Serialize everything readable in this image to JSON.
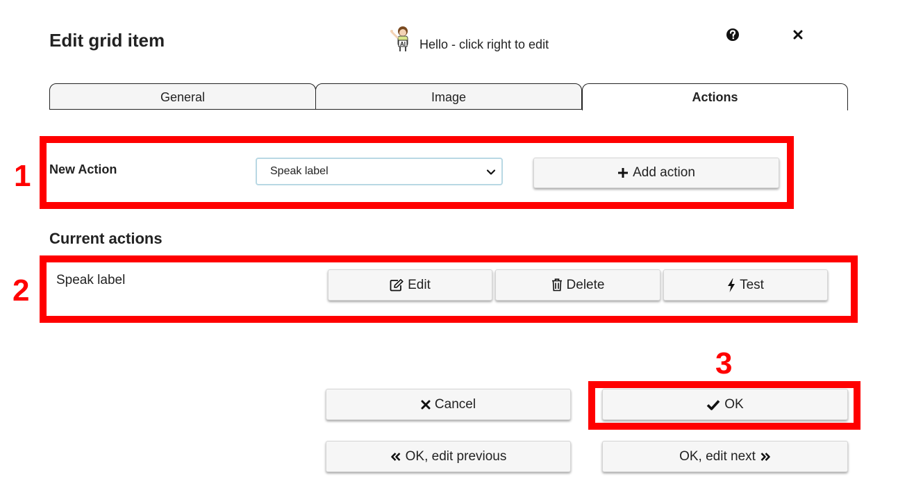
{
  "dialog": {
    "title": "Edit grid item",
    "hello_text": "Hello - click right to edit"
  },
  "tabs": [
    {
      "label": "General",
      "active": false
    },
    {
      "label": "Image",
      "active": false
    },
    {
      "label": "Actions",
      "active": true
    }
  ],
  "new_action": {
    "label": "New Action",
    "select_value": "Speak label",
    "add_button": "Add action"
  },
  "current_actions": {
    "title": "Current actions",
    "items": [
      {
        "name": "Speak label",
        "edit": "Edit",
        "delete": "Delete",
        "test": "Test"
      }
    ]
  },
  "footer": {
    "cancel": "Cancel",
    "ok": "OK",
    "ok_prev": "OK, edit previous",
    "ok_next": "OK, edit next"
  },
  "annotations": {
    "one": "1",
    "two": "2",
    "three": "3",
    "color": "#ff0000"
  },
  "icons": {
    "help": "question-circle-icon",
    "close": "close-icon",
    "add": "plus-icon",
    "edit": "pencil-square-icon",
    "delete": "trash-icon",
    "test": "bolt-icon",
    "cancel": "times-icon",
    "ok": "check-icon",
    "prev": "double-chevron-left-icon",
    "next": "double-chevron-right-icon"
  }
}
